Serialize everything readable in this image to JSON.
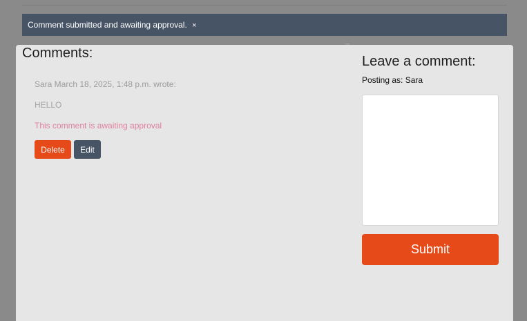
{
  "alert": {
    "message": "Comment submitted and awaiting approval.",
    "close_label": "×"
  },
  "comments": {
    "title": "Comments:",
    "items": [
      {
        "meta": "Sara March 18, 2025, 1:48 p.m. wrote:",
        "body": "HELLO",
        "status": "This comment is awaiting approval",
        "delete_label": "Delete",
        "edit_label": "Edit"
      }
    ]
  },
  "form": {
    "title": "Leave a comment:",
    "posting_as": "Posting as: Sara",
    "body_value": "",
    "submit_label": "Submit"
  },
  "colors": {
    "accent": "#e64a19",
    "alert_bg": "#475466",
    "pending_status": "#df7f9c",
    "panel_bg": "#e6e6e6",
    "overlay_bg": "#8a8a8a"
  }
}
